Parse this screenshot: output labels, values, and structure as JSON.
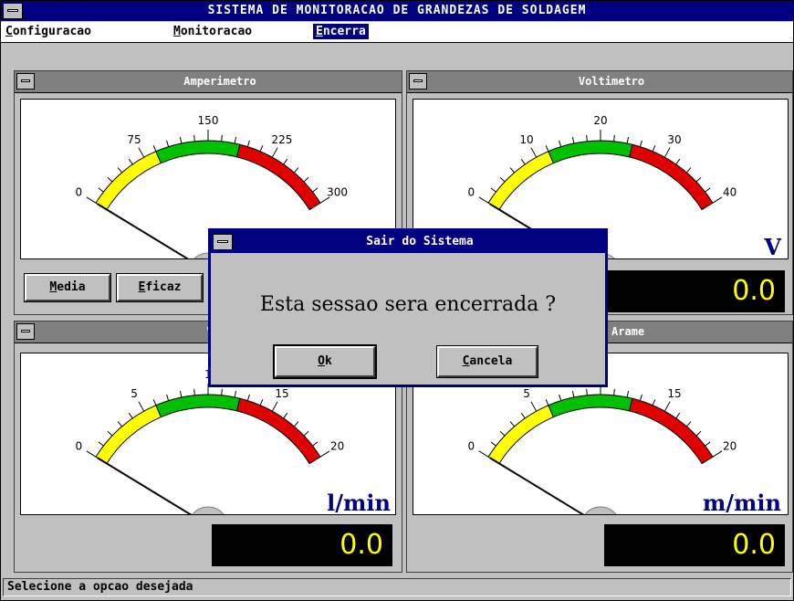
{
  "window": {
    "title": "SISTEMA DE MONITORACAO DE GRANDEZAS DE SOLDAGEM"
  },
  "menu": {
    "items": [
      {
        "hot": "C",
        "rest": "onfiguracao"
      },
      {
        "hot": "M",
        "rest": "onitoracao"
      },
      {
        "hot": "E",
        "rest": "ncerra"
      }
    ]
  },
  "panels": {
    "amperimetro": {
      "title": "Amperimetro",
      "ticks": [
        "0",
        "75",
        "150",
        "225",
        "300"
      ],
      "unit": "",
      "reading": "",
      "needle_fraction": 0.0,
      "buttons": [
        {
          "hot": "M",
          "rest": "edia"
        },
        {
          "hot": "E",
          "rest": "ficaz"
        }
      ]
    },
    "voltimetro": {
      "title": "Voltimetro",
      "ticks": [
        "0",
        "10",
        "20",
        "30",
        "40"
      ],
      "unit": "V",
      "reading": "0.0",
      "needle_fraction": 0.0
    },
    "vazao": {
      "title": "Vaza",
      "ticks": [
        "0",
        "5",
        "1",
        "15",
        "20"
      ],
      "unit": "l/min",
      "reading": "0.0",
      "needle_fraction": 0.0
    },
    "arame": {
      "title": "e do Arame",
      "ticks": [
        "0",
        "5",
        "",
        "15",
        "20"
      ],
      "unit": "m/min",
      "reading": "0.0",
      "needle_fraction": 0.0
    }
  },
  "dialog": {
    "title": "Sair do Sistema",
    "message": "Esta sessao sera encerrada ?",
    "ok": {
      "hot": "O",
      "rest": "k"
    },
    "cancel": {
      "hot": "C",
      "rest": "ancela"
    }
  },
  "status": "Selecione a opcao desejada",
  "colors": {
    "title": "#000080",
    "yellow": "#ffff00",
    "green": "#00c000",
    "red": "#e00000",
    "display_text": "#ffff00"
  }
}
